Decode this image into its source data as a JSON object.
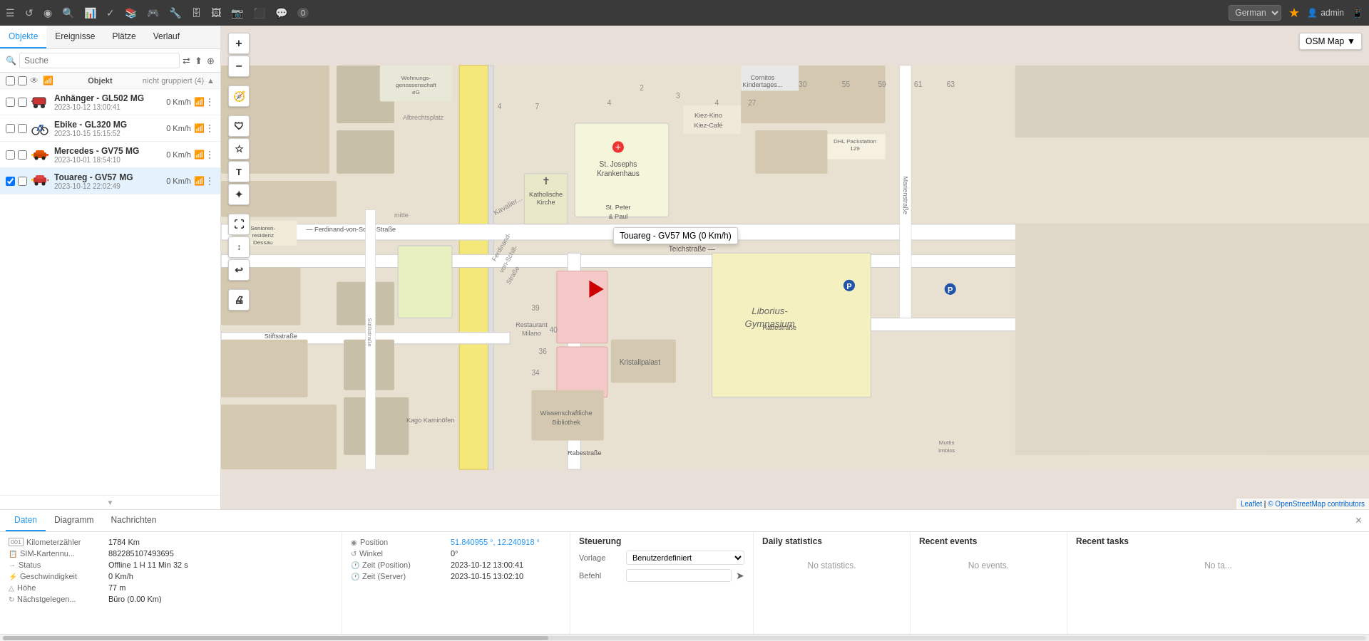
{
  "toolbar": {
    "icons": [
      "☰",
      "↺",
      "📍",
      "🔍",
      "📊",
      "✓",
      "📚",
      "🎮",
      "🔧",
      "🗄",
      "🖼",
      "📷",
      "⬛",
      "💬"
    ],
    "chat_badge": "0",
    "language": "German",
    "admin": "admin",
    "active_icon_index": 13
  },
  "sidebar": {
    "tabs": [
      "Objekte",
      "Ereignisse",
      "Plätze",
      "Verlauf"
    ],
    "active_tab": "Objekte",
    "search_placeholder": "Suche",
    "group_label": "Objekt",
    "group_name": "nicht gruppiert",
    "group_count": "4",
    "items": [
      {
        "id": "anhaenger",
        "name": "Anhänger - GL502 MG",
        "date": "2023-10-12 13:00:41",
        "speed": "0 Km/h",
        "checked_primary": false,
        "checked_secondary": false,
        "icon_type": "trailer",
        "icon_color": "#cc0000"
      },
      {
        "id": "ebike",
        "name": "Ebike - GL320 MG",
        "date": "2023-10-15 15:15:52",
        "speed": "0 Km/h",
        "checked_primary": false,
        "checked_secondary": false,
        "icon_type": "bike",
        "icon_color": "#2266cc"
      },
      {
        "id": "mercedes",
        "name": "Mercedes - GV75 MG",
        "date": "2023-10-01 18:54:10",
        "speed": "0 Km/h",
        "checked_primary": false,
        "checked_secondary": false,
        "icon_type": "car",
        "icon_color": "#cc4400"
      },
      {
        "id": "touareg",
        "name": "Touareg - GV57 MG",
        "date": "2023-10-12 22:02:49",
        "speed": "0 Km/h",
        "checked_primary": true,
        "checked_secondary": false,
        "icon_type": "car-arrow",
        "icon_color": "#cc0000",
        "selected": true
      }
    ]
  },
  "map": {
    "type_label": "OSM Map",
    "tooltip_text": "Touareg - GV57 MG (0 Km/h)",
    "attribution_text": "Leaflet",
    "attribution_osm": "© OpenStreetMap contributors"
  },
  "map_controls": {
    "zoom_in": "+",
    "zoom_out": "−",
    "buttons": [
      "🧭",
      "🛡",
      "⭐",
      "T",
      "✦",
      "⛶",
      "↕",
      "↩",
      "🖨"
    ]
  },
  "bottom_panel": {
    "tabs": [
      "Daten",
      "Diagramm",
      "Nachrichten"
    ],
    "active_tab": "Daten",
    "close_button": "×",
    "data_fields": [
      {
        "icon": "km",
        "label": "Kilometerzähler",
        "value": "1784 Km"
      },
      {
        "icon": "sim",
        "label": "SIM-Kartennu...",
        "value": "882285107493695"
      },
      {
        "icon": "status",
        "label": "Status",
        "value": "Offline 1 H 11 Min 32 s"
      },
      {
        "icon": "speed",
        "label": "Geschwindigkeit",
        "value": "0 Km/h"
      },
      {
        "icon": "height",
        "label": "Höhe",
        "value": "77 m"
      },
      {
        "icon": "location",
        "label": "Nächstgelegen...",
        "value": "Büro (0.00 Km)"
      }
    ],
    "position_fields": [
      {
        "icon": "pos",
        "label": "Position",
        "value": "51.840955 °, 12.240918 °",
        "is_link": true
      },
      {
        "icon": "angle",
        "label": "Winkel",
        "value": "0°"
      },
      {
        "icon": "time_pos",
        "label": "Zeit (Position)",
        "value": "2023-10-12 13:00:41"
      },
      {
        "icon": "time_srv",
        "label": "Zeit (Server)",
        "value": "2023-10-15 13:02:10"
      }
    ],
    "steuerung": {
      "title": "Steuerung",
      "vorlage_label": "Vorlage",
      "vorlage_value": "Benutzerdefiniert",
      "befehl_label": "Befehl",
      "befehl_placeholder": ""
    },
    "daily_stats": {
      "title": "Daily statistics",
      "no_data": "No statistics."
    },
    "recent_events": {
      "title": "Recent events",
      "no_data": "No events."
    },
    "recent_tasks": {
      "title": "Recent tasks",
      "no_data": "No ta..."
    }
  }
}
